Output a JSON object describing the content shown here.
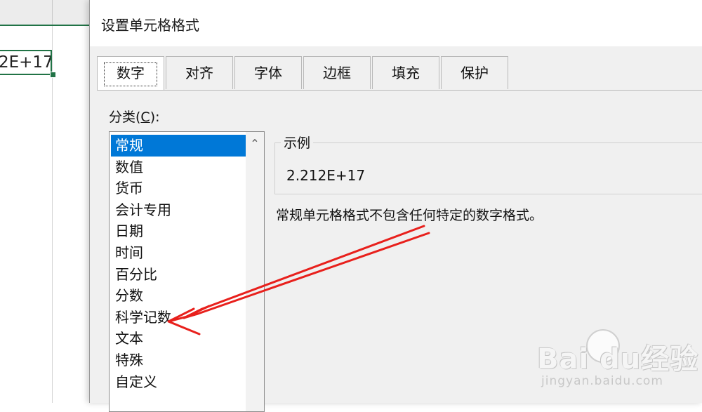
{
  "sheet": {
    "cell_value": "2E+17"
  },
  "dialog": {
    "title": "设置单元格格式",
    "tabs": [
      {
        "label": "数字"
      },
      {
        "label": "对齐"
      },
      {
        "label": "字体"
      },
      {
        "label": "边框"
      },
      {
        "label": "填充"
      },
      {
        "label": "保护"
      }
    ],
    "active_tab": 0,
    "category": {
      "label_prefix": "分类(",
      "label_key": "C",
      "label_suffix": "):",
      "items": [
        {
          "label": "常规"
        },
        {
          "label": "数值"
        },
        {
          "label": "货币"
        },
        {
          "label": "会计专用"
        },
        {
          "label": "日期"
        },
        {
          "label": "时间"
        },
        {
          "label": "百分比"
        },
        {
          "label": "分数"
        },
        {
          "label": "科学记数"
        },
        {
          "label": "文本"
        },
        {
          "label": "特殊"
        },
        {
          "label": "自定义"
        }
      ],
      "selected_index": 0
    },
    "sample": {
      "legend": "示例",
      "value": "2.212E+17"
    },
    "description": "常规单元格格式不包含任何特定的数字格式。"
  },
  "annotation": {
    "arrow_color": "#e8201c"
  },
  "watermark": {
    "brand": "Bai  du经验",
    "url": "jingyan.baidu.com"
  },
  "colors": {
    "selection": "#0078d7",
    "excel_green": "#217346"
  }
}
